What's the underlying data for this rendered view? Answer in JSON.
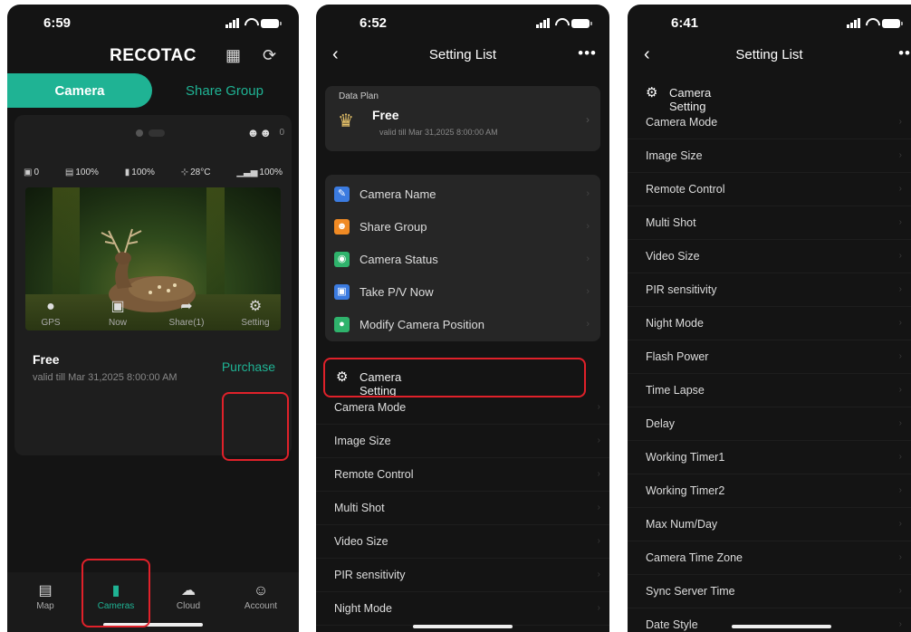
{
  "phone1": {
    "status_time": "6:59",
    "brand": "RECOTAC",
    "tabs": {
      "active": "Camera",
      "inactive": "Share  Group"
    },
    "share_count": "0",
    "stats": {
      "photos": "0",
      "sd": "100%",
      "battery": "100%",
      "temp": "28°C",
      "signal": "100%"
    },
    "plan_title": "Free",
    "plan_valid": "valid till Mar 31,2025 8:00:00 AM",
    "purchase": "Purchase",
    "actions": {
      "gps": "GPS",
      "now": "Now",
      "share": "Share(1)",
      "setting": "Setting"
    },
    "nav": {
      "map": "Map",
      "cameras": "Cameras",
      "cloud": "Cloud",
      "account": "Account"
    }
  },
  "phone2": {
    "status_time": "6:52",
    "title": "Setting List",
    "plan_label": "Data Plan",
    "plan_name": "Free",
    "plan_valid": "valid till Mar 31,2025 8:00:00 AM",
    "menu": [
      "Camera Name",
      "Share  Group",
      "Camera Status",
      "Take P/V  Now",
      "Modify Camera Position"
    ],
    "section": "Camera Setting",
    "rows": [
      "Camera Mode",
      "Image Size",
      "Remote Control",
      "Multi Shot",
      "Video Size",
      "PIR sensitivity",
      "Night Mode"
    ]
  },
  "phone3": {
    "status_time": "6:41",
    "title": "Setting List",
    "section": "Camera Setting",
    "rows": [
      "Camera Mode",
      "Image Size",
      "Remote Control",
      "Multi Shot",
      "Video Size",
      "PIR sensitivity",
      "Night Mode",
      "Flash Power",
      "Time Lapse",
      "Delay",
      "Working Timer1",
      "Working Timer2",
      "Max Num/Day",
      "Camera Time Zone",
      "Sync Server Time",
      "Date Style"
    ]
  },
  "colors": {
    "accent": "#1fb394",
    "highlight": "#e0212a",
    "background": "#141414",
    "card": "#262626"
  },
  "icons": {
    "back": "chevron-left-icon",
    "more": "more-icon",
    "refresh": "refresh-icon",
    "camera_setting": "camera-gear-icon",
    "crown": "crown-icon"
  }
}
